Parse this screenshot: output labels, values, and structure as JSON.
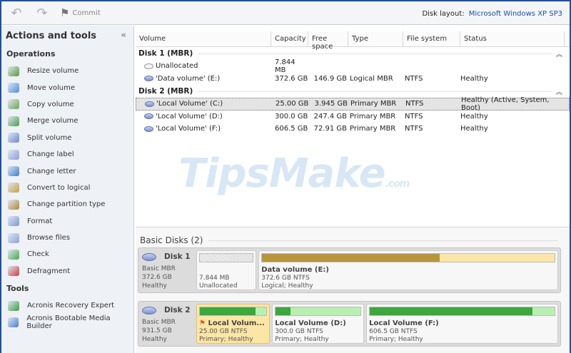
{
  "toolbar": {
    "undo": "undo-icon",
    "redo": "redo-icon",
    "commit_label": "Commit",
    "disk_layout_label": "Disk layout:",
    "disk_layout_value": "Microsoft Windows XP SP3"
  },
  "sidebar": {
    "title": "Actions and tools",
    "collapse": "«",
    "operations_label": "Operations",
    "operations": [
      {
        "label": "Resize volume",
        "color": "#5a9a3a"
      },
      {
        "label": "Move volume",
        "color": "#4d8ed8"
      },
      {
        "label": "Copy volume",
        "color": "#6aa84f"
      },
      {
        "label": "Merge volume",
        "color": "#4a9e4a"
      },
      {
        "label": "Split volume",
        "color": "#6c8ccc"
      },
      {
        "label": "Change label",
        "color": "#8aa0d8"
      },
      {
        "label": "Change letter",
        "color": "#3c7fc8"
      },
      {
        "label": "Convert to logical",
        "color": "#c8a040"
      },
      {
        "label": "Change partition type",
        "color": "#b08838"
      },
      {
        "label": "Format",
        "color": "#7a9ad0"
      },
      {
        "label": "Browse files",
        "color": "#8aa4d8"
      },
      {
        "label": "Check",
        "color": "#4aa84a"
      },
      {
        "label": "Defragment",
        "color": "#c84040"
      }
    ],
    "tools_label": "Tools",
    "tools": [
      {
        "label": "Acronis Recovery Expert",
        "color": "#3aa03a"
      },
      {
        "label": "Acronis Bootable Media Builder",
        "color": "#4a80c8"
      }
    ]
  },
  "table": {
    "columns": [
      "Volume",
      "Capacity",
      "Free space",
      "Type",
      "File system",
      "Status"
    ],
    "groups": [
      {
        "name": "Disk 1 (MBR)",
        "rows": [
          {
            "volume": "Unallocated",
            "capacity": "7.844 MB",
            "free": "",
            "type": "",
            "fs": "",
            "status": "",
            "empty": true
          },
          {
            "volume": "'Data volume' (E:)",
            "capacity": "372.6 GB",
            "free": "146.9 GB",
            "type": "Logical MBR",
            "fs": "NTFS",
            "status": "Healthy"
          }
        ]
      },
      {
        "name": "Disk 2 (MBR)",
        "rows": [
          {
            "volume": "'Local Volume' (C:)",
            "capacity": "25.00 GB",
            "free": "3.945 GB",
            "type": "Primary MBR",
            "fs": "NTFS",
            "status": "Healthy (Active, System, Boot)",
            "selected": true
          },
          {
            "volume": "'Local Volume' (D:)",
            "capacity": "300.0 GB",
            "free": "247.4 GB",
            "type": "Primary MBR",
            "fs": "NTFS",
            "status": "Healthy"
          },
          {
            "volume": "'Local Volume' (F:)",
            "capacity": "606.5 GB",
            "free": "72.91 GB",
            "type": "Primary MBR",
            "fs": "NTFS",
            "status": "Healthy"
          }
        ]
      }
    ]
  },
  "watermark": "TipsMake.com",
  "basic_disks": {
    "title": "Basic Disks (2)",
    "disks": [
      {
        "name": "Disk 1",
        "type": "Basic MBR",
        "size": "372.6 GB",
        "status": "Healthy",
        "partitions": [
          {
            "name": "",
            "size": "7.844 MB",
            "desc": "Unallocated",
            "used": 0,
            "unalloc": true,
            "flex": 1
          },
          {
            "name": "Data volume (E:)",
            "size": "372.6 GB NTFS",
            "desc": "Logical; Healthy",
            "used": 0.606,
            "flex": 5.4,
            "fill": "#b8953a",
            "bg": "#fbe5a8"
          }
        ]
      },
      {
        "name": "Disk 2",
        "type": "Basic MBR",
        "size": "931.5 GB",
        "status": "Healthy",
        "partitions": [
          {
            "name": "Local Volum...",
            "size": "25.00 GB NTFS",
            "desc": "Primary; Healthy",
            "used": 0.842,
            "flex": 1,
            "selected": true,
            "fill": "#3aa83a",
            "bg": "#b8f0b0"
          },
          {
            "name": "Local Volume (D:)",
            "size": "300.0 GB NTFS",
            "desc": "Primary; Healthy",
            "used": 0.176,
            "flex": 1.6,
            "fill": "#3aa83a",
            "bg": "#b8f0b0"
          },
          {
            "name": "Local Volume (F:)",
            "size": "606.5 GB NTFS",
            "desc": "Primary; Healthy",
            "used": 0.88,
            "flex": 3.45,
            "fill": "#3aa83a",
            "bg": "#b8f0b0"
          }
        ]
      }
    ]
  }
}
